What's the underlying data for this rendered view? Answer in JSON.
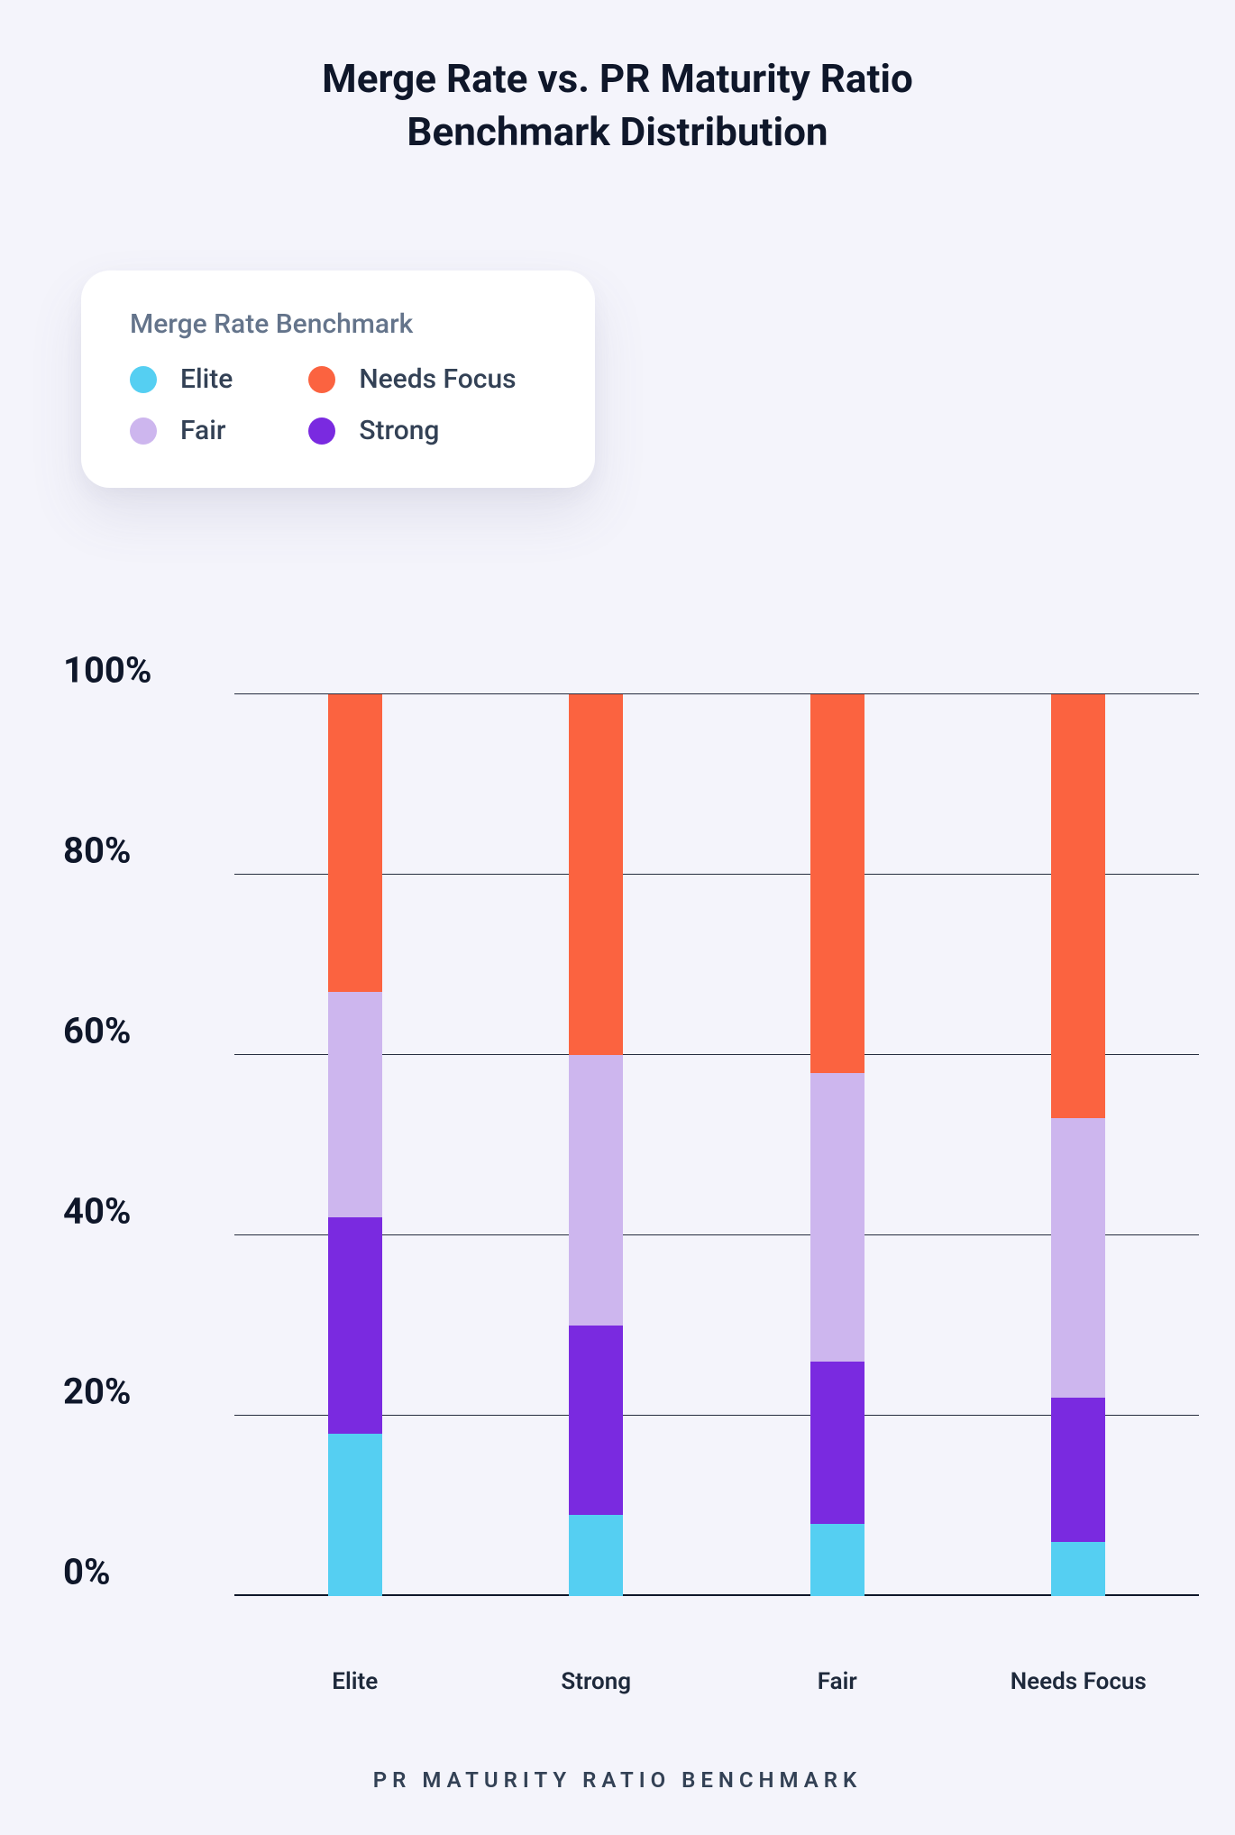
{
  "title_line1": "Merge Rate vs. PR Maturity Ratio",
  "title_line2": "Benchmark Distribution",
  "legend": {
    "title": "Merge Rate Benchmark",
    "items": [
      {
        "label": "Elite",
        "color": "#55cff2"
      },
      {
        "label": "Needs Focus",
        "color": "#fb6340"
      },
      {
        "label": "Fair",
        "color": "#cdb6ee"
      },
      {
        "label": "Strong",
        "color": "#7a2ae0"
      }
    ]
  },
  "x_axis_title": "PR MATURITY RATIO BENCHMARK",
  "y_ticks": [
    "0%",
    "20%",
    "40%",
    "60%",
    "80%",
    "100%"
  ],
  "chart_data": {
    "type": "bar",
    "stacked": true,
    "ylabel": "",
    "xlabel": "PR Maturity Ratio Benchmark",
    "ylim": [
      0,
      100
    ],
    "y_unit": "%",
    "categories": [
      "Elite",
      "Strong",
      "Fair",
      "Needs Focus"
    ],
    "series": [
      {
        "name": "Elite",
        "color": "#55cff2",
        "values": [
          18,
          9,
          8,
          6
        ]
      },
      {
        "name": "Strong",
        "color": "#7a2ae0",
        "values": [
          24,
          21,
          18,
          16
        ]
      },
      {
        "name": "Fair",
        "color": "#cdb6ee",
        "values": [
          25,
          30,
          32,
          31
        ]
      },
      {
        "name": "Needs Focus",
        "color": "#fb6340",
        "values": [
          33,
          40,
          42,
          47
        ]
      }
    ],
    "title": "Merge Rate vs. PR Maturity Ratio Benchmark Distribution"
  }
}
